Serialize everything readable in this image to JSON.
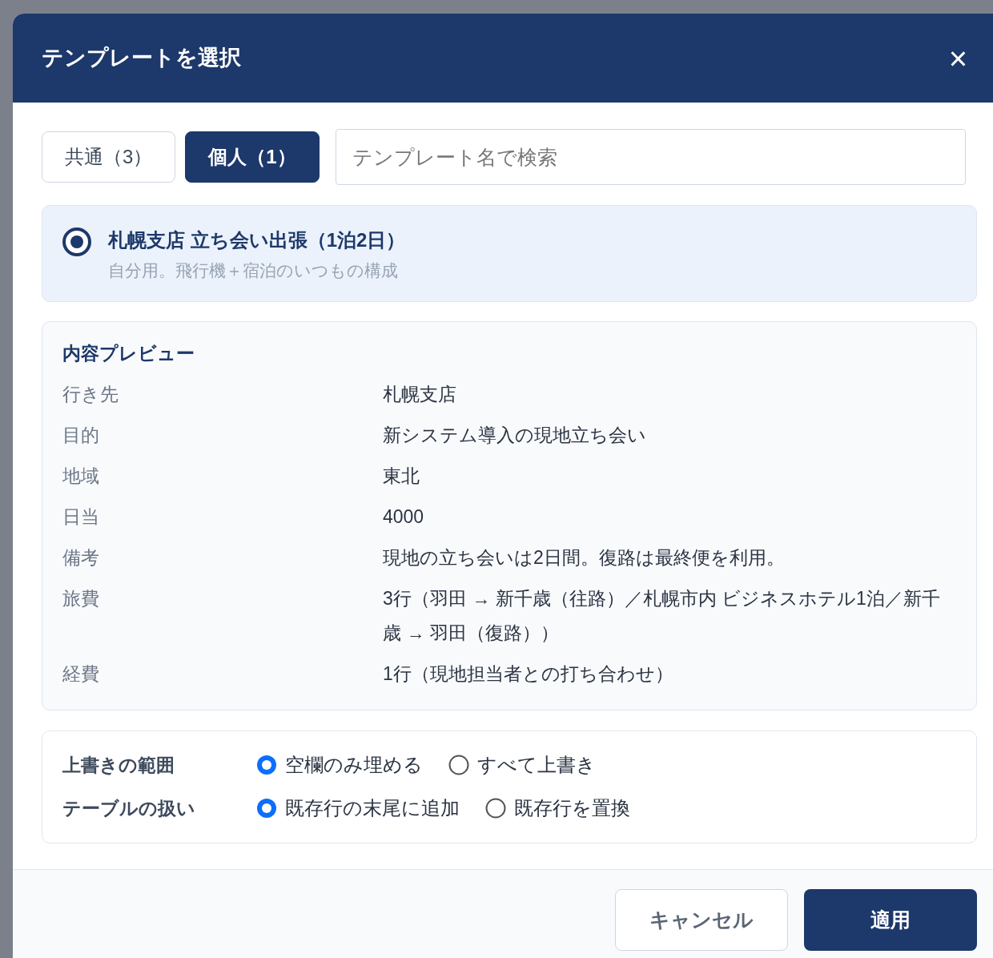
{
  "dialog": {
    "title": "テンプレートを選択",
    "close": "×"
  },
  "tabs": [
    {
      "label": "共通（3）",
      "selected": false
    },
    {
      "label": "個人（1）",
      "selected": true
    }
  ],
  "search": {
    "placeholder": "テンプレート名で検索"
  },
  "templates": [
    {
      "name": "札幌支店 立ち会い出張（1泊2日）",
      "description": "自分用。飛行機＋宿泊のいつもの構成",
      "selected": true
    }
  ],
  "preview": {
    "title": "内容プレビュー",
    "rows": [
      {
        "label": "行き先",
        "value": "札幌支店"
      },
      {
        "label": "目的",
        "value": "新システム導入の現地立ち会い"
      },
      {
        "label": "地域",
        "value": "東北"
      },
      {
        "label": "日当",
        "value": "4000"
      },
      {
        "label": "備考",
        "value": "現地の立ち会いは2日間。復路は最終便を利用。"
      },
      {
        "label": "旅費",
        "value": "3行（羽田 → 新千歳（往路）／札幌市内 ビジネスホテル1泊／新千歳 → 羽田（復路））"
      },
      {
        "label": "経費",
        "value": "1行（現地担当者との打ち合わせ）"
      }
    ]
  },
  "options": [
    {
      "label": "上書きの範囲",
      "choices": [
        {
          "label": "空欄のみ埋める",
          "selected": true
        },
        {
          "label": "すべて上書き",
          "selected": false
        }
      ]
    },
    {
      "label": "テーブルの扱い",
      "choices": [
        {
          "label": "既存行の末尾に追加",
          "selected": true
        },
        {
          "label": "既存行を置換",
          "selected": false
        }
      ]
    }
  ],
  "buttons": [
    {
      "label": "キャンセル",
      "kind": "secondary"
    },
    {
      "label": "適用",
      "kind": "primary"
    }
  ]
}
